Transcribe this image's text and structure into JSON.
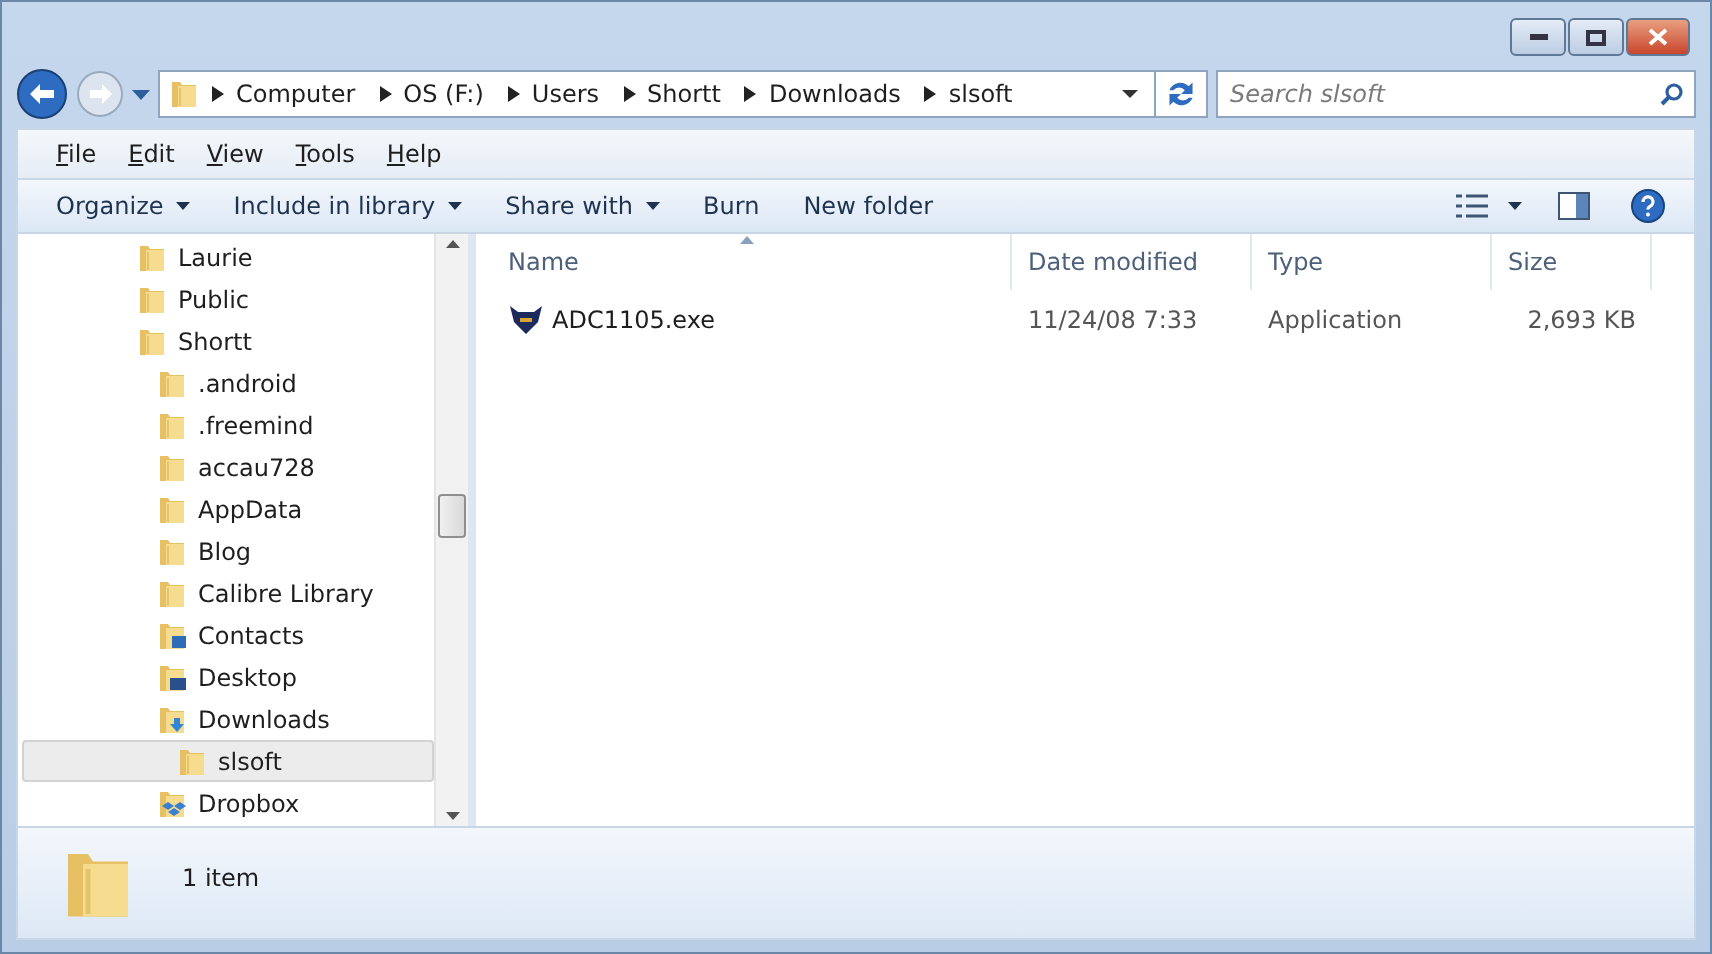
{
  "address_bar": {
    "breadcrumbs": [
      "Computer",
      "OS (F:)",
      "Users",
      "Shortt",
      "Downloads",
      "slsoft"
    ]
  },
  "search": {
    "placeholder": "Search slsoft"
  },
  "menu_bar": [
    {
      "label": "File"
    },
    {
      "label": "Edit"
    },
    {
      "label": "View"
    },
    {
      "label": "Tools"
    },
    {
      "label": "Help"
    }
  ],
  "toolbar": [
    {
      "label": "Organize",
      "has_menu": true
    },
    {
      "label": "Include in library",
      "has_menu": true
    },
    {
      "label": "Share with",
      "has_menu": true
    },
    {
      "label": "Burn",
      "has_menu": false
    },
    {
      "label": "New folder",
      "has_menu": false
    }
  ],
  "navigation_tree": [
    {
      "label": "Laurie",
      "kind": "folder",
      "selected": false
    },
    {
      "label": "Public",
      "kind": "folder",
      "selected": false
    },
    {
      "label": "Shortt",
      "kind": "folder",
      "selected": false,
      "children": [
        {
          "label": ".android",
          "kind": "folder",
          "selected": false
        },
        {
          "label": ".freemind",
          "kind": "folder",
          "selected": false
        },
        {
          "label": "accau728",
          "kind": "folder",
          "selected": false
        },
        {
          "label": "AppData",
          "kind": "folder",
          "selected": false
        },
        {
          "label": "Blog",
          "kind": "folder",
          "selected": false
        },
        {
          "label": "Calibre Library",
          "kind": "folder",
          "selected": false
        },
        {
          "label": "Contacts",
          "kind": "contacts",
          "selected": false
        },
        {
          "label": "Desktop",
          "kind": "desktop",
          "selected": false
        },
        {
          "label": "Downloads",
          "kind": "downloads",
          "selected": false,
          "children": [
            {
              "label": "slsoft",
              "kind": "folder",
              "selected": true
            }
          ]
        },
        {
          "label": "Dropbox",
          "kind": "dropbox",
          "selected": false
        }
      ]
    }
  ],
  "file_list": {
    "columns": [
      {
        "label": "Name",
        "sorted": true
      },
      {
        "label": "Date modified",
        "sorted": false
      },
      {
        "label": "Type",
        "sorted": false
      },
      {
        "label": "Size",
        "sorted": false
      }
    ],
    "rows": [
      {
        "name": "ADC1105.exe",
        "date_modified": "11/24/08 7:33",
        "type": "Application",
        "size": "2,693 KB"
      }
    ]
  },
  "status_bar": {
    "item_count": "1 item"
  }
}
